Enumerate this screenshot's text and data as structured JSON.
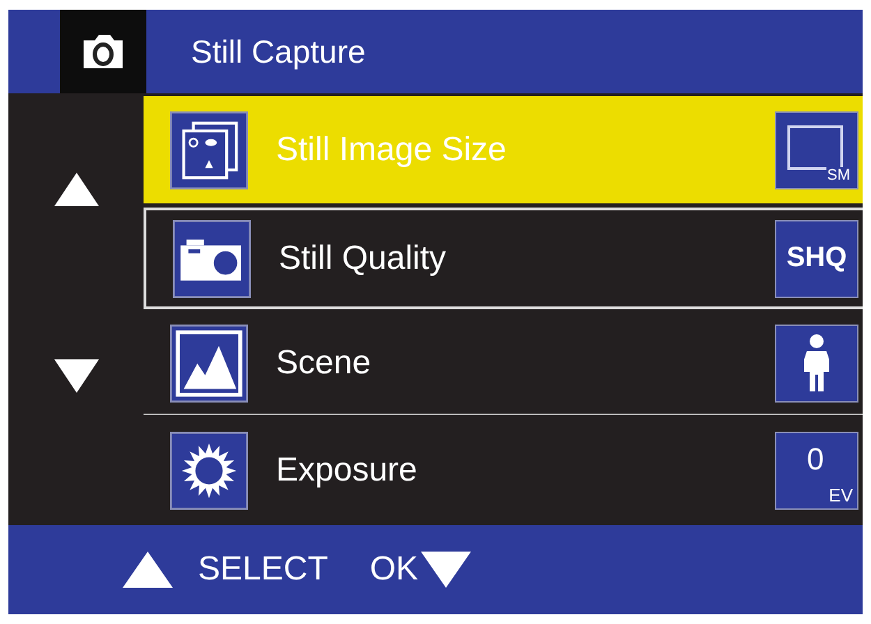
{
  "header": {
    "title": "Still Capture"
  },
  "menu": [
    {
      "label": "Still Image Size",
      "kind": "images",
      "selected": true,
      "outlined": false,
      "value": {
        "kind": "size",
        "text": "SM"
      }
    },
    {
      "label": "Still Quality",
      "kind": "camera",
      "selected": false,
      "outlined": true,
      "value": {
        "kind": "text",
        "text": "SHQ"
      }
    },
    {
      "label": "Scene",
      "kind": "mountain",
      "selected": false,
      "outlined": false,
      "value": {
        "kind": "person"
      }
    },
    {
      "label": "Exposure",
      "kind": "sun",
      "selected": false,
      "outlined": false,
      "value": {
        "kind": "ev",
        "text": "0",
        "unit": "EV"
      }
    }
  ],
  "footer": {
    "select": "SELECT",
    "ok": "OK"
  }
}
